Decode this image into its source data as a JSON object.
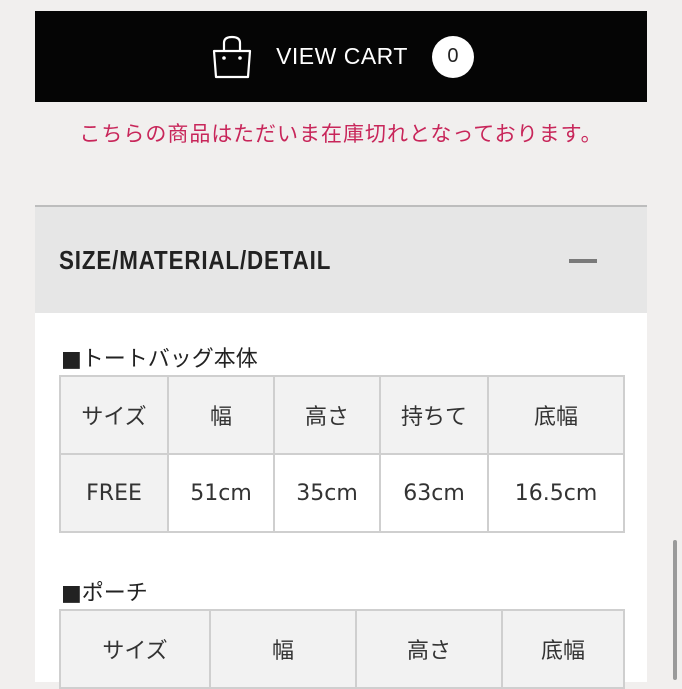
{
  "cart": {
    "label": "VIEW CART",
    "count": "0",
    "icon": "shopping-bag-icon"
  },
  "notice": "こちらの商品はただいま在庫切れとなっております。",
  "accordion": {
    "title": "SIZE/MATERIAL/DETAIL",
    "state_icon": "collapse-minus-icon"
  },
  "tote": {
    "title": "■トートバッグ本体",
    "headers": [
      "サイズ",
      "幅",
      "高さ",
      "持ちて",
      "底幅"
    ],
    "row": [
      "FREE",
      "51cm",
      "35cm",
      "63cm",
      "16.5cm"
    ]
  },
  "pouch": {
    "title": "■ポーチ",
    "headers": [
      "サイズ",
      "幅",
      "高さ",
      "底幅"
    ]
  },
  "colors": {
    "cart_bg": "#050505",
    "notice": "#c8265a",
    "accordion_bg": "#e6e6e6"
  }
}
